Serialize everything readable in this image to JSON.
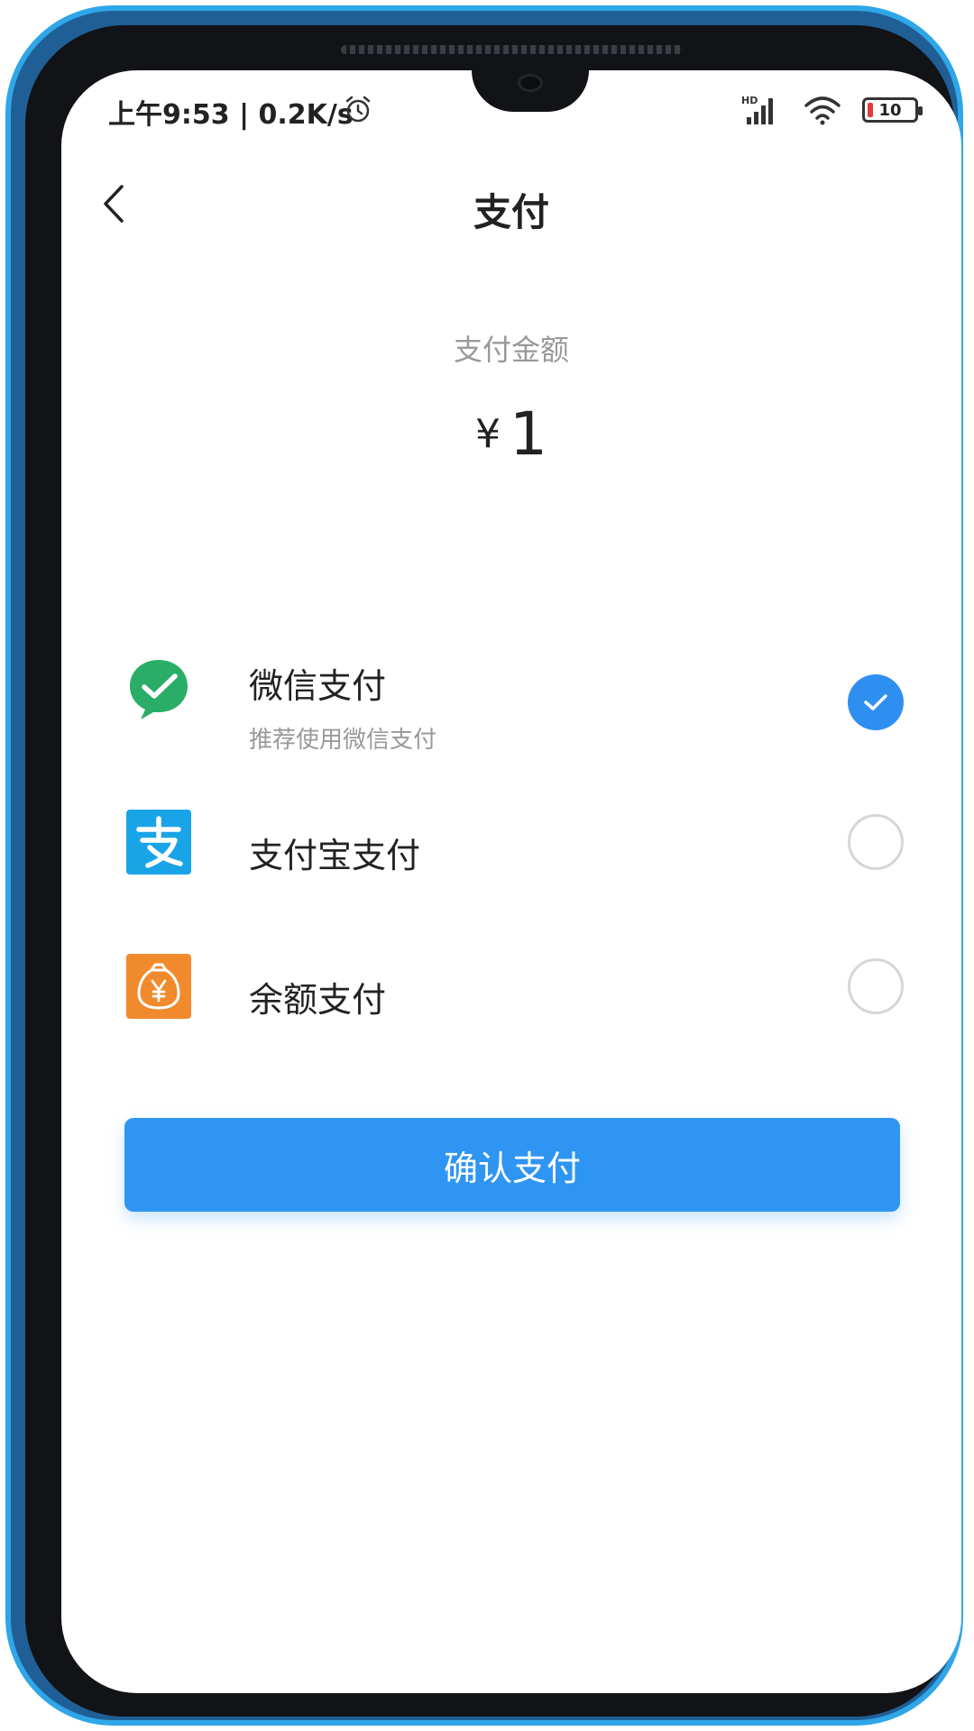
{
  "status_bar": {
    "time": "上午9:53 | 0.2K/s",
    "signal_label": "HD",
    "battery": "10"
  },
  "header": {
    "title": "支付"
  },
  "amount": {
    "label": "支付金额",
    "currency": "¥",
    "value": "1"
  },
  "payment_options": [
    {
      "title": "微信支付",
      "subtitle": "推荐使用微信支付",
      "icon": "wechat-pay-icon",
      "selected": true,
      "color": "#2aae67"
    },
    {
      "title": "支付宝支付",
      "icon": "alipay-icon",
      "selected": false,
      "color": "#1aa4e8"
    },
    {
      "title": "余额支付",
      "icon": "money-bag-icon",
      "selected": false,
      "color": "#f08a2c"
    }
  ],
  "confirm": {
    "label": "确认支付"
  },
  "colors": {
    "accent": "#2f95f2",
    "check": "#2f8ff0"
  }
}
